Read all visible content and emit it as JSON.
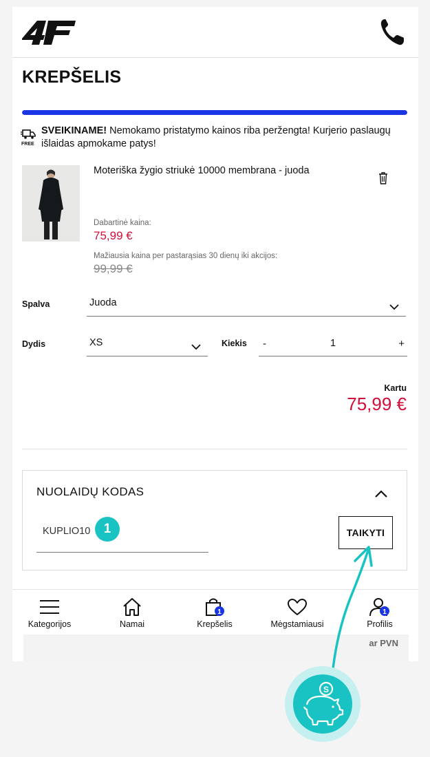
{
  "header": {
    "logo_text": "4F",
    "icons": {
      "logo": "4f-logo",
      "phone": "phone-icon"
    }
  },
  "page": {
    "title": "KREPŠELIS"
  },
  "shipping": {
    "progress_percent": 100,
    "accent_color": "#1a35e6",
    "truck_label": "FREE",
    "bold": "SVEIKINAME!",
    "message": " Nemokamo pristatymo kainos riba peržengta! Kurjerio paslaugų išlaidas apmokame patys!"
  },
  "product": {
    "name": "Moteriška žygio striukė 10000 membrana - juoda",
    "current_price_label": "Dabartinė kaina:",
    "current_price": "75,99 €",
    "lowest_price_label": "Mažiausia kaina per pastarąsias 30 dienų iki akcijos:",
    "old_price": "99,99 €",
    "price_color": "#d0103a"
  },
  "options": {
    "color_label": "Spalva",
    "color_value": "Juoda",
    "size_label": "Dydis",
    "size_value": "XS",
    "qty_label": "Kiekis",
    "qty_minus": "-",
    "qty_value": "1",
    "qty_plus": "+"
  },
  "total": {
    "label": "Kartu",
    "value": "75,99 €"
  },
  "discount": {
    "title": "NUOLAIDŲ KODAS",
    "code_value": "KUPLIO10",
    "apply_label": "TAIKYTI",
    "step_badge": "1"
  },
  "bottom_nav": {
    "items": [
      {
        "label": "Kategorijos",
        "icon": "menu-icon"
      },
      {
        "label": "Namai",
        "icon": "home-icon"
      },
      {
        "label": "Krepšelis",
        "icon": "bag-icon",
        "badge": "1"
      },
      {
        "label": "Mėgstamiausi",
        "icon": "heart-icon"
      },
      {
        "label": "Profilis",
        "icon": "user-icon",
        "badge": "1"
      }
    ]
  },
  "footer": {
    "vat_text": "ar PVN"
  },
  "annotation": {
    "color": "#19c3c3",
    "icon": "piggy-bank-icon",
    "coin_symbol": "S"
  }
}
